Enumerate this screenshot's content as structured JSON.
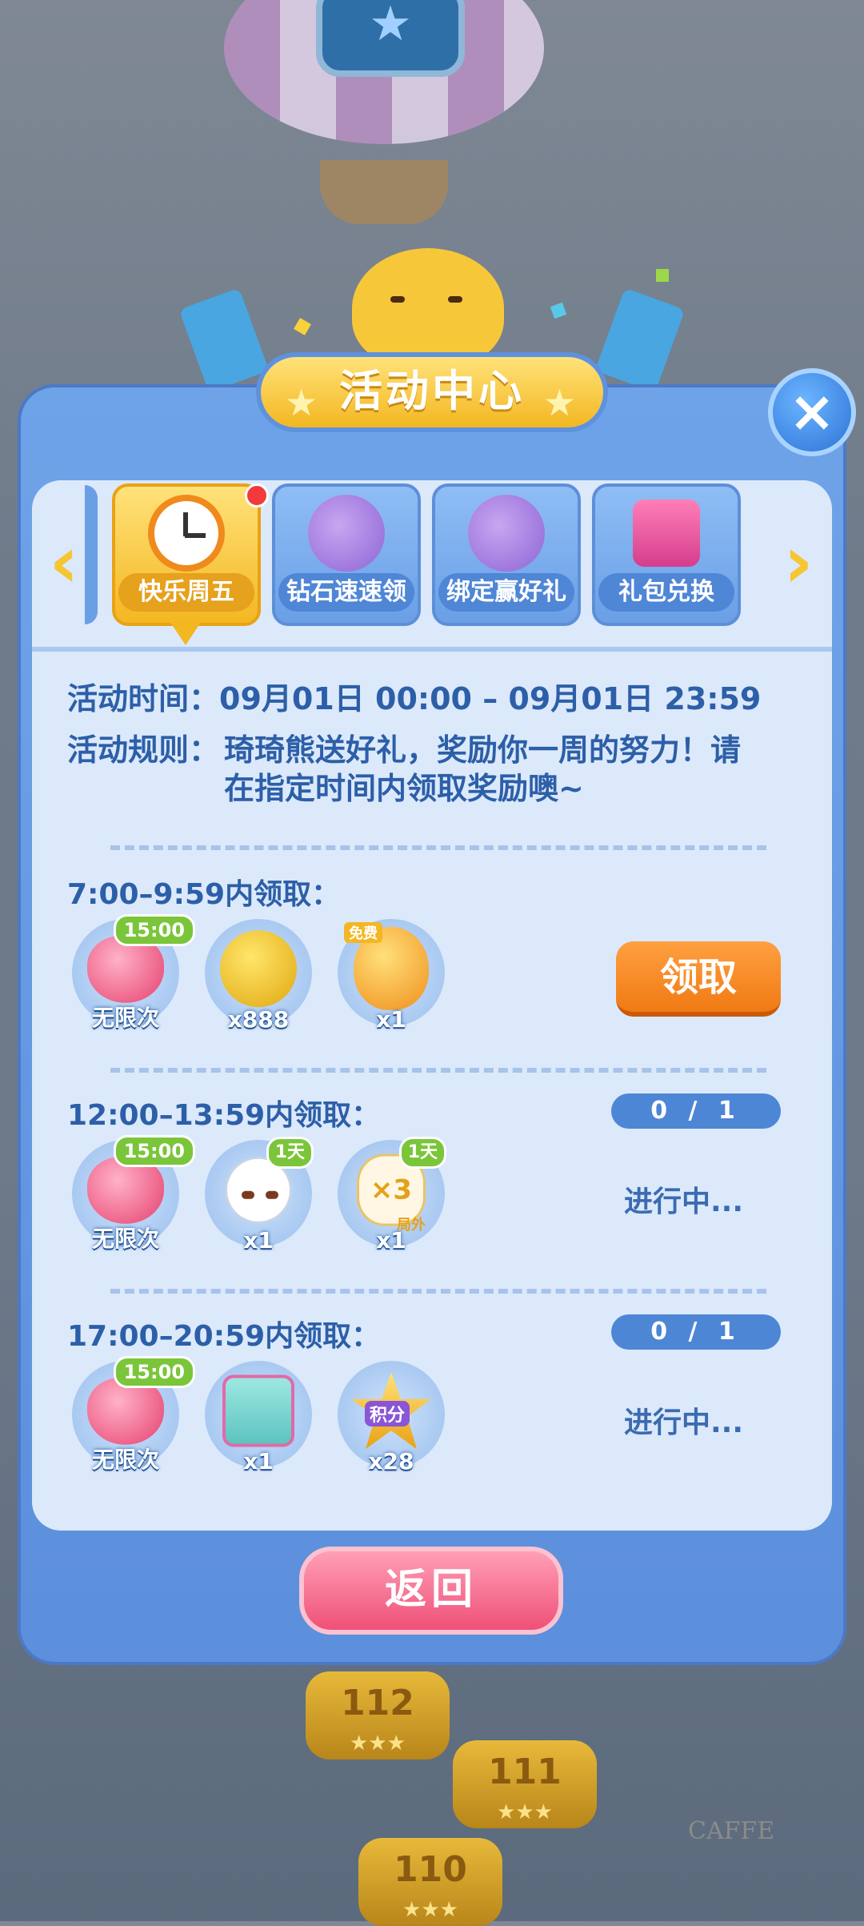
{
  "header": {
    "title": "活动中心"
  },
  "tabs": [
    {
      "label": "快乐周五",
      "active": true,
      "icon": "clock-icon",
      "notification": true
    },
    {
      "label": "钻石速速领",
      "active": false,
      "icon": "purple-cat-icon"
    },
    {
      "label": "绑定赢好礼",
      "active": false,
      "icon": "purple-cat-icon"
    },
    {
      "label": "礼包兑换",
      "active": false,
      "icon": "gift-box-icon"
    }
  ],
  "event": {
    "time_label": "活动时间：",
    "time_value": "09月01日 00:00 – 09月01日 23:59",
    "rules_label": "活动规则：",
    "rules_line1": "琦琦熊送好礼，奖励你一周的努力！请",
    "rules_line2": "在指定时间内领取奖励噢~"
  },
  "slots": [
    {
      "title": "7:00–9:59内领取：",
      "rewards": [
        {
          "icon": "heart-icon",
          "qty": "无限次",
          "badge": "15:00"
        },
        {
          "icon": "gold-coin-icon",
          "qty": "x888"
        },
        {
          "icon": "golden-egg-icon",
          "qty": "x1",
          "tag": "免费"
        }
      ],
      "action": "领取"
    },
    {
      "title": "12:00–13:59内领取：",
      "progress": "0 / 1",
      "rewards": [
        {
          "icon": "heart-icon",
          "qty": "无限次",
          "badge": "15:00"
        },
        {
          "icon": "bunny-icon",
          "qty": "x1",
          "badge": "1天"
        },
        {
          "icon": "triple-glove-icon",
          "qty": "x1",
          "badge": "1天",
          "overlay": "×3",
          "tag": "局外"
        }
      ],
      "status": "进行中..."
    },
    {
      "title": "17:00–20:59内领取：",
      "progress": "0 / 1",
      "rewards": [
        {
          "icon": "heart-icon",
          "qty": "无限次",
          "badge": "15:00"
        },
        {
          "icon": "gift-chick-icon",
          "qty": "x1"
        },
        {
          "icon": "points-star-icon",
          "qty": "x28",
          "overlay": "积分"
        }
      ],
      "status": "进行中..."
    }
  ],
  "footer": {
    "back_label": "返回"
  },
  "background": {
    "levels": [
      {
        "num": "112"
      },
      {
        "num": "111"
      },
      {
        "num": "110"
      }
    ],
    "stars": "★★★",
    "cafe_sign": "CAFFE"
  },
  "colors": {
    "panel": "#5c8fdc",
    "accent": "#f3b722",
    "claim": "#f07a13",
    "back": "#ef5078"
  }
}
